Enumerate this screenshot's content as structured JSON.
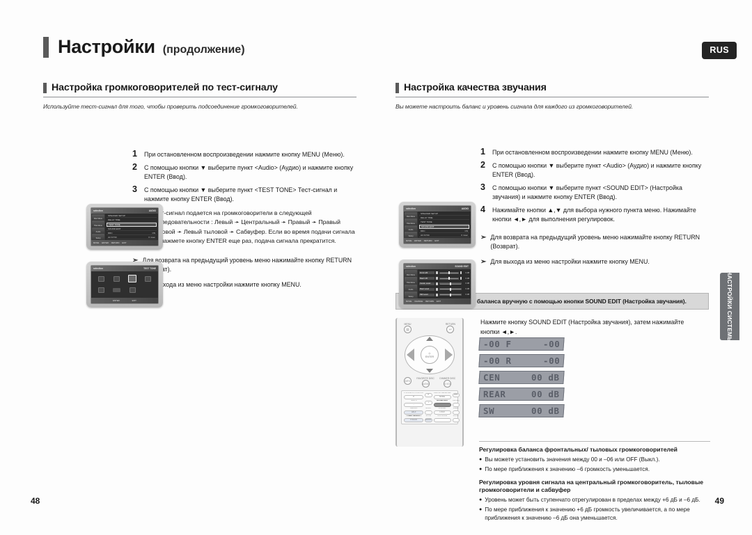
{
  "header": {
    "title_main": "Настройки",
    "title_sub": "(продолжение)",
    "lang_badge": "RUS"
  },
  "side_tab": {
    "label": "НАСТРОЙКИ СИСТЕМЫ"
  },
  "left_column": {
    "section_title": "Настройка громкоговорителей по тест-сигналу",
    "intro": "Используйте тест-сигнал для того, чтобы проверить подсоединение громкоговорителей.",
    "steps": [
      {
        "num": "1",
        "text": "При остановленном воспроизведении нажмите кнопку MENU (Меню)."
      },
      {
        "num": "2",
        "text": "С помощью кнопки ▼ выберите пункт <Audio> (Аудио) и нажмите кнопку ENTER (Ввод)."
      },
      {
        "num": "3",
        "text": "С помощью кнопки ▼ выберите пункт <TEST TONE> Тест-сигнал и нажмите кнопку ENTER (Ввод)."
      }
    ],
    "bullet": "Тест-сигнал подается на громкоговорители в следующей последовательности : Левый ➛ Центральный ➛ Правый ➛ Правый тыловой ➛ Левый тыловой ➛ Сабвуфер. Если во время подачи сигнала вы нажмете кнопку ENTER еще раз, подача сигнала прекратится.",
    "notes": [
      "Для возврата на предыдущий уровень меню нажимайте кнопку RETURN (Возврат).",
      "Для выхода из меню настройки нажмите кнопку MENU."
    ],
    "screen1": {
      "topbar_left": "selection",
      "topbar_right": "AUDIO",
      "sidebar": [
        "Disc Menu",
        "Title Menu",
        "Audio",
        "Setup"
      ],
      "rows": [
        {
          "label": "SPEAKER SETUP",
          "value": ""
        },
        {
          "label": "DELAY TIME",
          "value": ""
        },
        {
          "label": "TEST TONE",
          "value": "",
          "highlight": true
        },
        {
          "label": "SOUND EDIT",
          "value": ""
        },
        {
          "label": "DRC",
          "value": "ON"
        },
        {
          "label": "AV-SYNC",
          "value": "0 msec"
        }
      ],
      "botbar": [
        "MOVE",
        "ENTER",
        "RETURN",
        "EXIT"
      ]
    },
    "screen2": {
      "topbar_left": "selection",
      "topbar_right": "TEST TONE",
      "botbar": [
        "ENTER",
        "EXIT"
      ]
    }
  },
  "right_column": {
    "section_title": "Настройка качества звучания",
    "intro": "Вы можете настроить баланс и уровень сигнала для каждого из громкоговорителей.",
    "steps": [
      {
        "num": "1",
        "text": "При остановленном воспроизведении нажмите кнопку MENU (Меню)."
      },
      {
        "num": "2",
        "text": "С помощью кнопки ▼ выберите пункт <Audio> (Аудио) и нажмите кнопку ENTER (Ввод)."
      },
      {
        "num": "3",
        "text": "С помощью кнопки ▼ выберите пункт <SOUND EDIT> (Настройка звучания) и нажмите кнопку ENTER (Ввод)."
      },
      {
        "num": "4",
        "text": "Нажимайте кнопки ▲,▼ для выбора нужного пункта меню. Нажимайте кнопки ◄,► для выполнения регулировок."
      }
    ],
    "notes": [
      "Для возврата на предыдущий уровень меню нажимайте кнопку RETURN (Возврат).",
      "Для выхода из меню настройки нажмите кнопку MENU."
    ],
    "screen1": {
      "topbar_left": "selection",
      "topbar_right": "AUDIO",
      "sidebar": [
        "Disc Menu",
        "Title Menu",
        "Audio",
        "Setup"
      ],
      "rows": [
        {
          "label": "SPEAKER SETUP",
          "value": ""
        },
        {
          "label": "DELAY TIME",
          "value": ""
        },
        {
          "label": "TEST TONE",
          "value": ""
        },
        {
          "label": "SOUND EDIT",
          "value": "",
          "highlight": true
        },
        {
          "label": "DRC",
          "value": "ON"
        },
        {
          "label": "AV-SYNC",
          "value": "0 msec"
        }
      ],
      "botbar": [
        "MOVE",
        "ENTER",
        "RETURN",
        "EXIT"
      ]
    },
    "screen2": {
      "topbar_left": "selection",
      "topbar_right": "SOUND EDIT",
      "sidebar": [
        "Disc Menu",
        "Title Menu",
        "Audio",
        "Setup"
      ],
      "rows": [
        {
          "label": "Front L/R",
          "sub": "L/R",
          "value": "0 dB"
        },
        {
          "label": "Rear L/R",
          "sub": "L/R",
          "value": "0 dB"
        },
        {
          "label": "Center Level",
          "sub": "",
          "value": "0 dB"
        },
        {
          "label": "Rear Level",
          "sub": "",
          "value": "0 dB"
        },
        {
          "label": "SW Level",
          "sub": "",
          "value": "0 dB"
        }
      ],
      "botbar": [
        "MOVE",
        "CHANGE",
        "RETURN",
        "EXIT"
      ]
    },
    "banner": "Регулировка громкости и баланса вручную с помощью кнопки SOUND EDIT (Настройка звучания).",
    "display_intro": "Нажмите кнопку SOUND EDIT (Настройка звучания), затем нажимайте кнопки ◄,►.",
    "displays": [
      {
        "left": "-00 F",
        "right": "-00"
      },
      {
        "left": "-00 R",
        "right": "-00"
      },
      {
        "left": "CEN",
        "right": "00 dB"
      },
      {
        "left": "REAR",
        "right": "00 dB"
      },
      {
        "left": "SW",
        "right": "00 dB"
      }
    ],
    "notes_block": [
      {
        "heading": "Регулировка баланса фронтальных/ тыловых громкоговорителей",
        "items": [
          "Вы можете установить значения между 00 и –06 или OFF (Выкл.).",
          "По мере приближения к значению –6 громкость уменьшается."
        ]
      },
      {
        "heading": "Регулировка уровня сигнала на центральный громкоговоритель, тыловые громкоговорители и сабвуфер",
        "items": [
          "Уровень может быть ступенчато отрегулирован в пределах между +6 дБ и –6 дБ.",
          "По мере приближения к значению +6 дБ громкость увеличивается, а по мере приближения к значению –6 дБ она уменьшается."
        ]
      }
    ]
  },
  "remote": {
    "menu_label": "MENU",
    "return_label": "RETURN",
    "enter_label": "ENTER",
    "row2": [
      {
        "top": "",
        "label": "INFO"
      },
      {
        "top": "FAVORITE DISC",
        "label": "AUDIO"
      },
      {
        "top": "DIMMER DISC",
        "label": "S.VOL"
      }
    ],
    "grid": [
      {
        "top": "P.SCAN/PIP POSITION",
        "label": "P",
        "dark": false
      },
      {
        "top": "",
        "label": "P",
        "dark": false
      },
      {
        "top": "MD/DVD RECEIVER",
        "label": "MODE",
        "dark": false
      },
      {
        "top": "",
        "label": "RDS",
        "dark": false
      },
      {
        "top": "TEMPO",
        "label": "–",
        "dark": false
      },
      {
        "top": "",
        "label": "+",
        "dark": false
      },
      {
        "top": "SOUND EDIT",
        "label": "",
        "dark": true
      },
      {
        "top": "DSP/EQ",
        "label": "",
        "dark": false
      },
      {
        "top": "REMAIN",
        "label": "HALF",
        "dark": false
      },
      {
        "top": "ECHO",
        "label": "",
        "dark": false
      },
      {
        "top": "DIMMER",
        "label": "LOGO",
        "dark": false
      },
      {
        "top": "SLEEP",
        "label": "",
        "dark": false
      },
      {
        "top": "TUNER MEMORY",
        "label": "P.SCAN",
        "dark": false
      },
      {
        "top": "SLOW",
        "label": "MO/ST",
        "dark": false
      },
      {
        "top": "SUB MODE",
        "label": "",
        "dark": false
      },
      {
        "top": "ZOOM",
        "label": "",
        "dark": false
      }
    ]
  },
  "page_numbers": {
    "left": "48",
    "right": "49"
  },
  "colors": {
    "accent_bar": "#5a5a5a",
    "badge_bg": "#242424",
    "side_tab_bg": "#6e7175",
    "banner_bg": "#d8d8d8",
    "display_bg": "#9b9ea6",
    "display_fg": "#5b5f69"
  }
}
